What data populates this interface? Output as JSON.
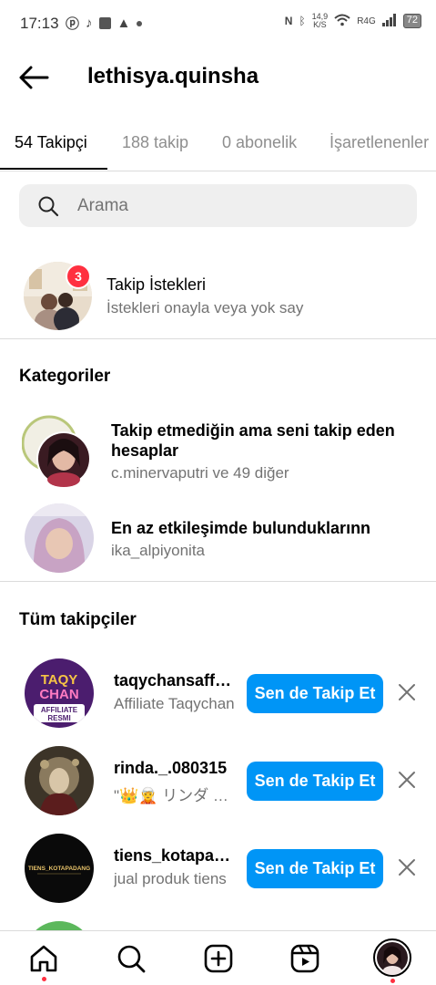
{
  "status_bar": {
    "time": "17:13",
    "speed_value": "14,9",
    "speed_unit": "K/S",
    "network": "R4G",
    "battery": "72"
  },
  "header": {
    "username": "lethisya.quinsha"
  },
  "tabs": [
    {
      "label": "54 Takipçi",
      "active": true
    },
    {
      "label": "188 takip",
      "active": false
    },
    {
      "label": "0 abonelik",
      "active": false
    },
    {
      "label": "İşaretlenenler",
      "active": false
    }
  ],
  "search": {
    "placeholder": "Arama"
  },
  "follow_requests": {
    "badge_count": "3",
    "title": "Takip İstekleri",
    "subtitle": "İstekleri onayla veya yok say"
  },
  "categories": {
    "heading": "Kategoriler",
    "items": [
      {
        "title": "Takip etmediğin ama seni takip eden hesaplar",
        "subtitle": "c.minervaputri ve 49 diğer"
      },
      {
        "title": "En az etkileşimde bulunduklarınn",
        "subtitle": "ika_alpiyonita"
      }
    ]
  },
  "followers": {
    "heading": "Tüm takipçiler",
    "follow_label": "Sen de Takip Et",
    "items": [
      {
        "username": "taqychansaffrespmi",
        "subtitle": "Affiliate Taqychan",
        "avatar_lines": [
          "TAQY",
          "CHAN",
          "AFFILIATE",
          "RESMI"
        ]
      },
      {
        "username": "rinda._.080315",
        "subtitle": "\"👑🧝 リンダ ✨\""
      },
      {
        "username": "tiens_kotapadang",
        "subtitle": "jual produk tiens",
        "avatar_lines": [
          "TIENS_KOTAPADANG"
        ]
      }
    ]
  },
  "bottom_nav": [
    "home-icon",
    "search-icon",
    "create-icon",
    "reels-icon",
    "profile-avatar"
  ],
  "colors": {
    "accent": "#0095f6",
    "badge": "#ff3040",
    "secondary_text": "#737373"
  }
}
